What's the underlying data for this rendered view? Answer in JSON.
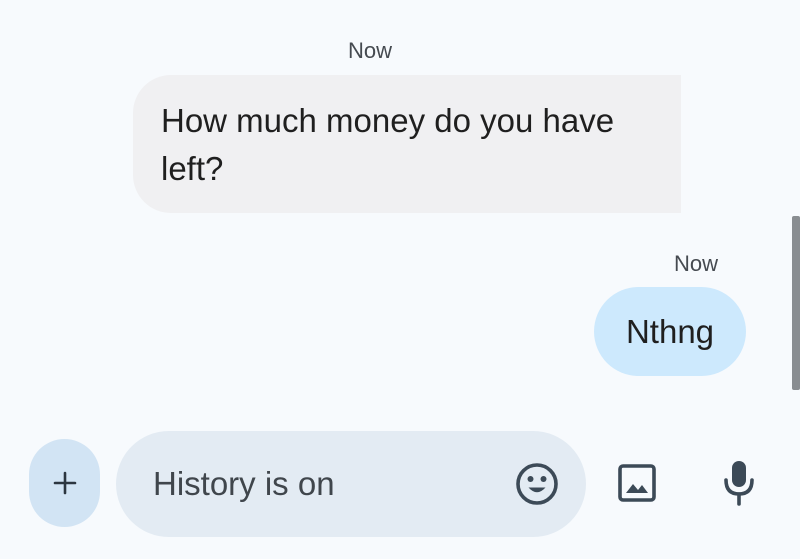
{
  "conversation": {
    "messages": [
      {
        "direction": "incoming",
        "timestamp": "Now",
        "text": "How much money do you have left?"
      },
      {
        "direction": "outgoing",
        "timestamp": "Now",
        "text": "Nthng"
      }
    ]
  },
  "composer": {
    "add_icon": "plus-icon",
    "placeholder": "History is on",
    "value": "",
    "emoji_icon": "emoji-icon",
    "gallery_icon": "image-icon",
    "mic_icon": "microphone-icon"
  },
  "colors": {
    "background": "#f7fafd",
    "incoming_bubble": "#f0f0f2",
    "outgoing_bubble": "#cde9fd",
    "compose_field": "#e3ebf3",
    "add_button": "#d2e4f4",
    "icon": "#3c4a57"
  }
}
